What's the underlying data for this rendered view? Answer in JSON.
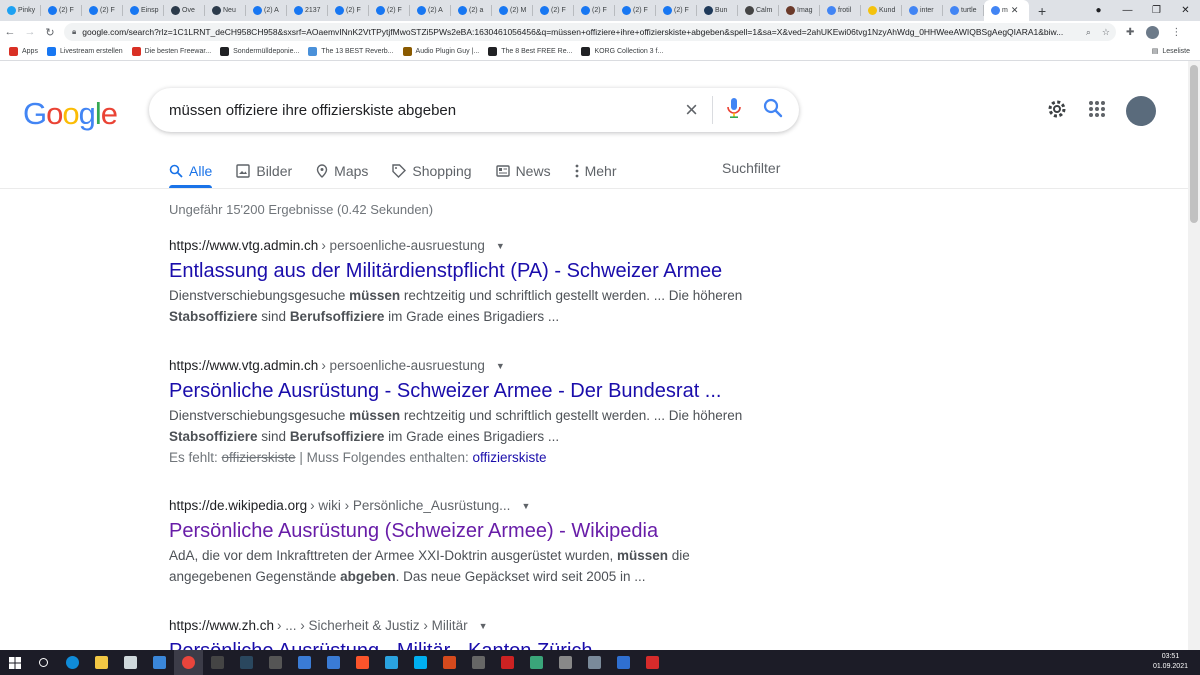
{
  "browser": {
    "tabs": [
      {
        "label": "Pinky",
        "icon": "twitter-icon",
        "color": "#1da1f2"
      },
      {
        "label": "(2) F",
        "icon": "facebook-icon",
        "color": "#1877f2"
      },
      {
        "label": "(2) F",
        "icon": "facebook-icon",
        "color": "#1877f2"
      },
      {
        "label": "Einsp",
        "icon": "facebook-icon",
        "color": "#1877f2"
      },
      {
        "label": "Ove",
        "icon": "dark-site-icon",
        "color": "#2b3a4a"
      },
      {
        "label": "Neu",
        "icon": "dark-site-icon",
        "color": "#2b3a4a"
      },
      {
        "label": "(2) A",
        "icon": "facebook-icon",
        "color": "#1877f2"
      },
      {
        "label": "2137",
        "icon": "facebook-icon",
        "color": "#1877f2"
      },
      {
        "label": "(2) F",
        "icon": "facebook-icon",
        "color": "#1877f2"
      },
      {
        "label": "(2) F",
        "icon": "facebook-icon",
        "color": "#1877f2"
      },
      {
        "label": "(2) A",
        "icon": "facebook-icon",
        "color": "#1877f2"
      },
      {
        "label": "(2) a",
        "icon": "facebook-icon",
        "color": "#1877f2"
      },
      {
        "label": "(2) M",
        "icon": "facebook-icon",
        "color": "#1877f2"
      },
      {
        "label": "(2) F",
        "icon": "facebook-icon",
        "color": "#1877f2"
      },
      {
        "label": "(2) F",
        "icon": "facebook-icon",
        "color": "#1877f2"
      },
      {
        "label": "(2) F",
        "icon": "facebook-icon",
        "color": "#1877f2"
      },
      {
        "label": "(2) F",
        "icon": "facebook-icon",
        "color": "#1877f2"
      },
      {
        "label": "Bun",
        "icon": "news-icon",
        "color": "#1f3a5a"
      },
      {
        "label": "Calm",
        "icon": "dots-icon",
        "color": "#444444"
      },
      {
        "label": "Imag",
        "icon": "image-icon",
        "color": "#6b3a2a"
      },
      {
        "label": "frotil",
        "icon": "google-icon",
        "color": "#4285f4"
      },
      {
        "label": "Kund",
        "icon": "yellow-site-icon",
        "color": "#f4c20d"
      },
      {
        "label": "inter",
        "icon": "google-icon",
        "color": "#4285f4"
      },
      {
        "label": "turtle",
        "icon": "google-icon",
        "color": "#4285f4"
      }
    ],
    "active_tab": {
      "label": "m",
      "icon": "google-icon",
      "color": "#4285f4"
    },
    "new_tab": "+",
    "url": "google.com/search?rlz=1C1LRNT_deCH958CH958&sxsrf=AOaemvINnK2VtTPytjfMwoSTZi5PWs2eBA:1630461056456&q=müssen+offiziere+ihre+offizierskiste+abgeben&spell=1&sa=X&ved=2ahUKEwi06tvg1NzyAhWdg_0HHWeeAWIQBSgAegQIARA1&biw...",
    "bookmarks": [
      {
        "label": "Apps",
        "icon": "apps-grid-icon",
        "color": "#d93025"
      },
      {
        "label": "Livestream erstellen",
        "icon": "facebook-icon",
        "color": "#1877f2"
      },
      {
        "label": "Die besten Freewar...",
        "icon": "star-icon",
        "color": "#d93025"
      },
      {
        "label": "Sondermülldeponie...",
        "icon": "w-icon",
        "color": "#202124"
      },
      {
        "label": "The 13 BEST Reverb...",
        "icon": "wave-icon",
        "color": "#4a90d9"
      },
      {
        "label": "Audio Plugin Guy |...",
        "icon": "plugin-icon",
        "color": "#8a5a00"
      },
      {
        "label": "The 8 Best FREE Re...",
        "icon": "moon-icon",
        "color": "#202124"
      },
      {
        "label": "KORG Collection 3 f...",
        "icon": "korg-icon",
        "color": "#202124"
      }
    ],
    "reading_list": "Leseliste"
  },
  "search": {
    "query": "müssen offiziere ihre offizierskiste abgeben",
    "logo": [
      "G",
      "o",
      "o",
      "g",
      "l",
      "e"
    ],
    "logo_colors": [
      "#4285f4",
      "#ea4335",
      "#fbbc05",
      "#4285f4",
      "#34a853",
      "#ea4335"
    ]
  },
  "nav": {
    "tabs": [
      {
        "label": "Alle",
        "icon": "search-icon",
        "active": true
      },
      {
        "label": "Bilder",
        "icon": "image-icon"
      },
      {
        "label": "Maps",
        "icon": "map-pin-icon"
      },
      {
        "label": "Shopping",
        "icon": "tag-icon"
      },
      {
        "label": "News",
        "icon": "newspaper-icon"
      },
      {
        "label": "Mehr",
        "icon": "more-vert-icon"
      }
    ],
    "filter": "Suchfilter"
  },
  "stats": "Ungefähr 15'200 Ergebnisse (0.42 Sekunden)",
  "results": [
    {
      "host": "https://www.vtg.admin.ch",
      "path": " › persoenliche-ausruestung",
      "title": "Entlassung aus der Militärdienstpflicht (PA) - Schweizer Armee",
      "snippet_line1": "Dienstverschiebungsgesuche <b>müssen</b> rechtzeitig und schriftlich gestellt werden. ... Die höheren",
      "snippet_line2": "<b>Stabsoffiziere</b> sind <b>Berufsoffiziere</b> im Grade eines Brigadiers ..."
    },
    {
      "host": "https://www.vtg.admin.ch",
      "path": " › persoenliche-ausruestung",
      "title": "Persönliche Ausrüstung - Schweizer Armee - Der Bundesrat ...",
      "snippet_line1": "Dienstverschiebungsgesuche <b>müssen</b> rechtzeitig und schriftlich gestellt werden. ... Die höheren",
      "snippet_line2": "<b>Stabsoffiziere</b> sind <b>Berufsoffiziere</b> im Grade eines Brigadiers ...",
      "missing_label": "Es fehlt:",
      "missing_term": "offizierskiste",
      "must_include": "| Muss Folgendes enthalten:",
      "must_include_link": "offizierskiste"
    },
    {
      "host": "https://de.wikipedia.org",
      "path": " › wiki › Persönliche_Ausrüstung...",
      "title": "Persönliche Ausrüstung (Schweizer Armee) - Wikipedia",
      "snippet_line1": "AdA, die vor dem Inkrafttreten der Armee XXI-Doktrin ausgerüstet wurden, <b>müssen</b> die",
      "snippet_line2": "angegebenen Gegenstände <b>abgeben</b>. Das neue Gepäckset wird seit 2005 in ..."
    },
    {
      "host": "https://www.zh.ch",
      "path": " › ... › Sicherheit & Justiz › Militär",
      "title": "Persönliche Ausrüstung - Militär - Kanton Zürich"
    }
  ],
  "taskbar": {
    "apps": [
      {
        "name": "search-icon",
        "color": "#ffffff"
      },
      {
        "name": "edge-icon",
        "color": "#0f8bd8"
      },
      {
        "name": "explorer-icon",
        "color": "#f2c744"
      },
      {
        "name": "store-icon",
        "color": "#cfd8dc"
      },
      {
        "name": "mail-icon",
        "color": "#3a86d9"
      },
      {
        "name": "chrome-icon",
        "color": "#e8453c"
      },
      {
        "name": "app-icon",
        "color": "#444444"
      },
      {
        "name": "steam-icon",
        "color": "#2a475e"
      },
      {
        "name": "live-icon",
        "color": "#555555"
      },
      {
        "name": "app-icon",
        "color": "#3a7bd5"
      },
      {
        "name": "app-icon",
        "color": "#3a7bd5"
      },
      {
        "name": "brave-icon",
        "color": "#fb542b"
      },
      {
        "name": "telegram-icon",
        "color": "#2aa3e0"
      },
      {
        "name": "skype-icon",
        "color": "#00aff0"
      },
      {
        "name": "app-icon",
        "color": "#d64a1d"
      },
      {
        "name": "app-icon",
        "color": "#666666"
      },
      {
        "name": "app-icon",
        "color": "#cc2222"
      },
      {
        "name": "app-icon",
        "color": "#3aa57a"
      },
      {
        "name": "app-icon",
        "color": "#888888"
      },
      {
        "name": "app-icon",
        "color": "#7a8a9a"
      },
      {
        "name": "app-icon",
        "color": "#2f6fd0"
      },
      {
        "name": "app-icon",
        "color": "#d62b2b"
      }
    ],
    "time": "03:51",
    "date": "01.09.2021"
  }
}
